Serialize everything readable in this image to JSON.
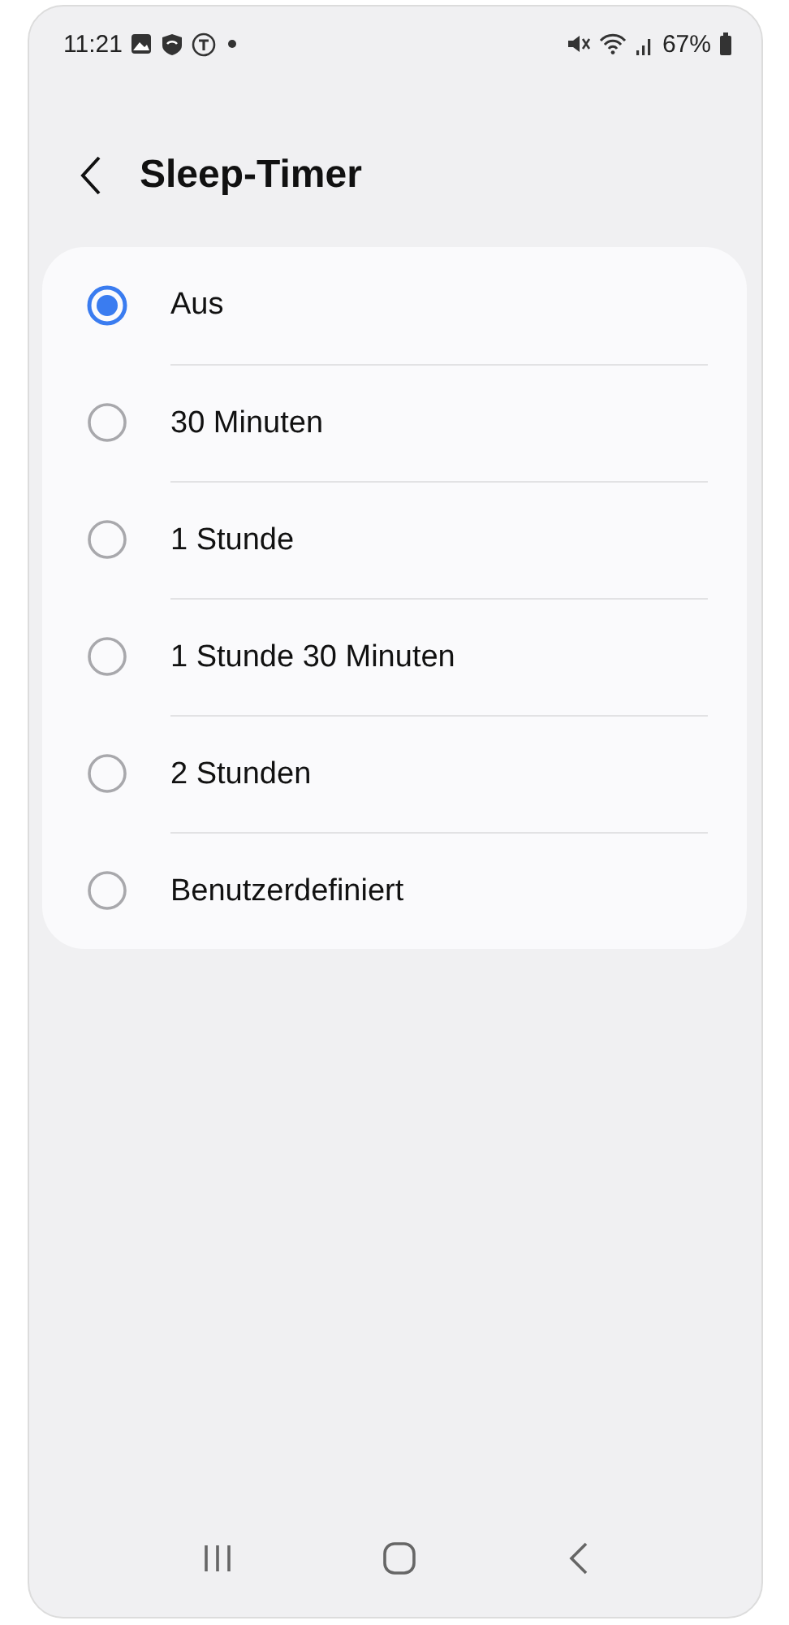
{
  "status_bar": {
    "time": "11:21",
    "battery": "67%"
  },
  "header": {
    "title": "Sleep-Timer"
  },
  "options": [
    {
      "label": "Aus",
      "selected": true
    },
    {
      "label": "30 Minuten",
      "selected": false
    },
    {
      "label": "1 Stunde",
      "selected": false
    },
    {
      "label": "1 Stunde 30 Minuten",
      "selected": false
    },
    {
      "label": "2 Stunden",
      "selected": false
    },
    {
      "label": "Benutzerdefiniert",
      "selected": false
    }
  ]
}
